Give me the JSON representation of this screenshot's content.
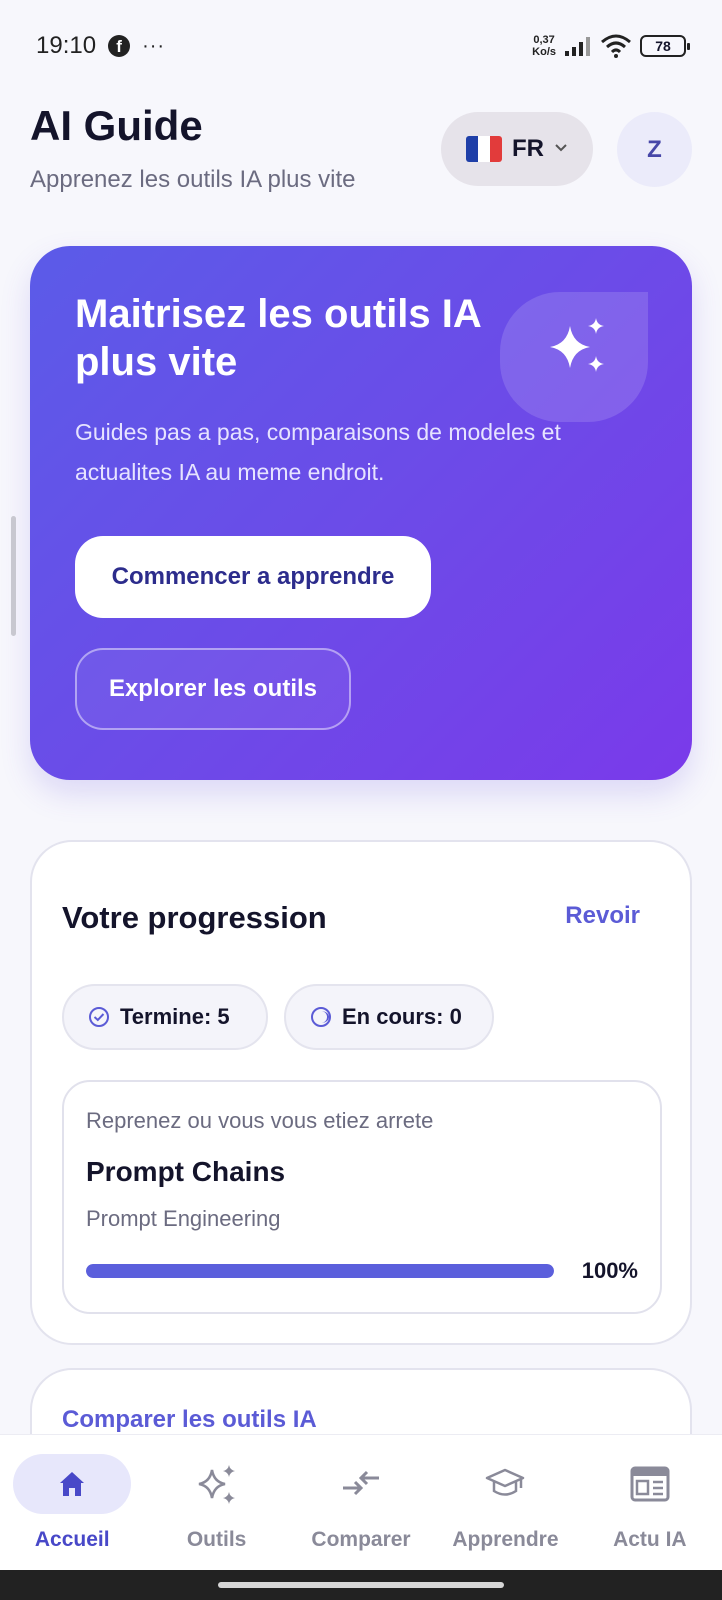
{
  "status_bar": {
    "time": "19:10",
    "more": "···",
    "net_speed_value": "0,37",
    "net_speed_unit": "Ko/s",
    "battery": "78"
  },
  "header": {
    "title": "AI Guide",
    "subtitle": "Apprenez les outils IA plus vite",
    "language": "FR",
    "avatar_initial": "Z"
  },
  "hero": {
    "title": "Maitrisez les outils IA plus vite",
    "description": "Guides pas a pas, comparaisons de modeles et actualites IA au meme endroit.",
    "primary_button": "Commencer a apprendre",
    "secondary_button": "Explorer les outils"
  },
  "progress": {
    "title": "Votre progression",
    "review_link": "Revoir",
    "completed": "Termine: 5",
    "in_progress": "En cours: 0",
    "resume": {
      "hint": "Reprenez ou vous vous etiez arrete",
      "lesson": "Prompt Chains",
      "course": "Prompt Engineering",
      "percent_label": "100%",
      "progress_value": 1.0
    }
  },
  "compare": {
    "title": "Comparer les outils IA"
  },
  "bottom_nav": {
    "items": [
      {
        "label": "Accueil",
        "icon": "home-icon",
        "active": true
      },
      {
        "label": "Outils",
        "icon": "sparkles-icon",
        "active": false
      },
      {
        "label": "Comparer",
        "icon": "compare-arrows-icon",
        "active": false
      },
      {
        "label": "Apprendre",
        "icon": "graduation-cap-icon",
        "active": false
      },
      {
        "label": "Actu IA",
        "icon": "newspaper-icon",
        "active": false
      }
    ]
  },
  "colors": {
    "accent": "#5b5bd6",
    "hero_start": "#5b5be8",
    "hero_end": "#7a3aea",
    "progress_fill": "#5b5fdc",
    "background": "#f7f7fc"
  }
}
